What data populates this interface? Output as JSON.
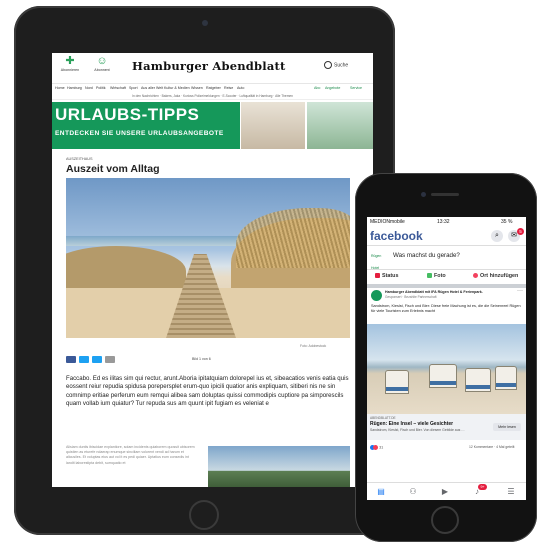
{
  "colors": {
    "brand_green": "#15985a",
    "facebook_blue": "#3b5998",
    "device": "#1e1e1e"
  },
  "tablet": {
    "nav": {
      "left_items": [
        "Abonnieren",
        "Abonnent"
      ],
      "logo": "Hamburger Abendblatt",
      "search": "Suche",
      "search_icon": "search-icon"
    },
    "menu": {
      "items": [
        "Home",
        "Hamburg",
        "Nord",
        "Politik",
        "Wirtschaft",
        "Sport",
        "Aus aller Welt",
        "Kultur & Medien",
        "Wissen",
        "Ratgeber",
        "Reise",
        "Auto"
      ],
      "right_items": [
        "Abo",
        "Angebote",
        "Service"
      ]
    },
    "subnews": "In den Nachrichten · Bakers, Jaka · Kurioss Polizeimeldungen · E-Scooter · Luftqualität in Hamburg · Alle Themen",
    "banner": {
      "title": "URLAUBS-TIPPS",
      "subtitle": "ENTDECKEN SIE UNSERE URLAUBSANGEBOTE"
    },
    "article": {
      "rubrik": "AUSZEITHAUS",
      "headline": "Auszeit vom Alltag",
      "photo_credit": "Foto: Adobestock",
      "pager": "Bild 1 von 6",
      "share_icons": [
        "facebook-icon",
        "twitter-icon",
        "xing-icon",
        "mail-icon"
      ],
      "lead": "Faccabo. Ed es ilitas sim qui rectur, arunt.Aboria ipitatquiam dolorepel ius et, sibeacatios venis eatia quis eossent reiur repudia spidusa porepersplet erum-quo ipicili quatior anis expliquam, sitiberi nis ne sin comnimp eritiae perferum eum remqui alibea sam doluptas quissi commodipis cuptiore pa simporescils quam vollab ium quiatur? Tur repuda sus am quunt ipit fugiam es veleniat e",
      "small_text": "Alisiam duntis ibiscidae explantiore, solam incidents quiaborem quossit ubisorem quistien as eturefe ndaerap enumque sinciliam volorent vendi ad harum et alicusiles. Et voluptas eius aut vol it es pedi quiaer. Uptatius eum consedis int landit laborestipta debit, sumquatio et"
    }
  },
  "phone": {
    "status": {
      "carrier": "MEDIONmobile",
      "time": "13:32",
      "battery": "35 %"
    },
    "fb": {
      "logo": "facebook",
      "search_icon": "search-icon",
      "messenger_icon": "messenger-icon",
      "badge": "5",
      "composer_name": "Rügen Hotel",
      "composer_prompt": "Was machst du gerade?",
      "actions": [
        "Status",
        "Foto",
        "Ort hinzufügen"
      ]
    },
    "post": {
      "author": "Hamburger Abendblatt mit IFA Rügen Hotel & Ferienpark.",
      "meta": "Gesponsert · Bezahlte Partnerschaft",
      "text": "Sandstrom, Kieslst, Fisch und Bier: Diese freie Machung ist es, die die Seinenreel Rügen für viele Touristen zum Erlebnis macht",
      "link_domain": "ABENDBLATT.DE",
      "link_title": "Rügen: Eine Insel – viele Gesichter",
      "link_desc": "Sandstrom, Kieslst, Fisch und Bier. Von diesem Gebilde aus …",
      "button": "Mehr lesen",
      "reactions": "31",
      "comments": "12 Kommentare · 4 Mal geteilt"
    },
    "tabs": [
      "news-feed-icon",
      "friends-icon",
      "watch-icon",
      "notifications-icon",
      "menu-icon"
    ],
    "tab_badge": "9+"
  }
}
